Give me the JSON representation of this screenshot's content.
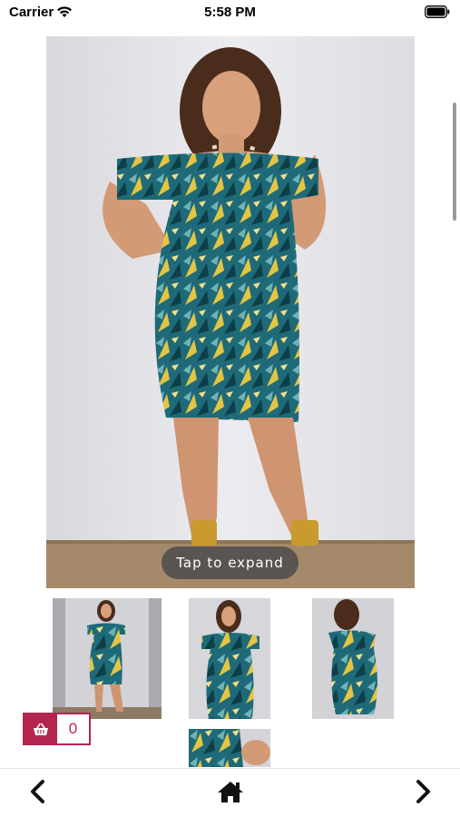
{
  "status_bar": {
    "carrier": "Carrier",
    "time": "5:58 PM"
  },
  "product_gallery": {
    "expand_hint": "Tap to expand",
    "thumbnail_count": 4
  },
  "cart": {
    "count": "0",
    "icon": "basket-icon"
  },
  "bottom_nav": {
    "back_icon": "chevron-left-icon",
    "home_icon": "home-icon",
    "forward_icon": "chevron-right-icon"
  },
  "colors": {
    "accent": "#b3264f",
    "background": "#ffffff",
    "photo_backdrop": "#e2e2e6",
    "hint_bg": "#46464b"
  }
}
